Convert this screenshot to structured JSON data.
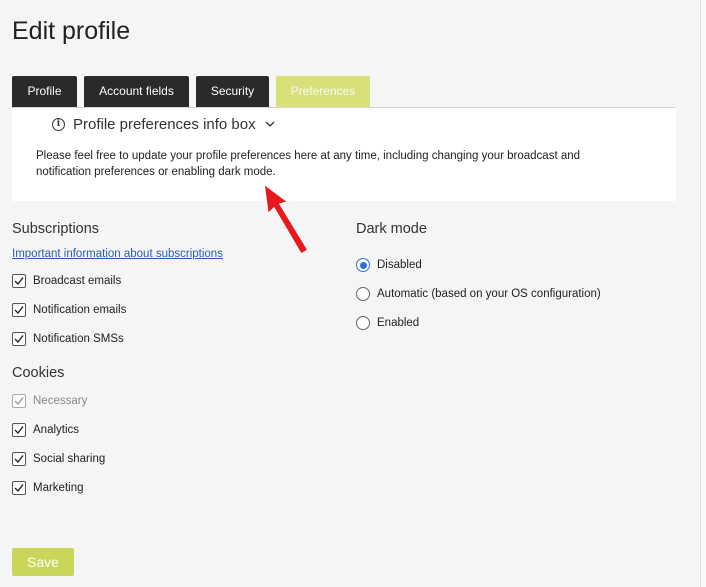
{
  "page_title": "Edit profile",
  "tabs": [
    {
      "label": "Profile",
      "active": false
    },
    {
      "label": "Account fields",
      "active": false
    },
    {
      "label": "Security",
      "active": false
    },
    {
      "label": "Preferences",
      "active": true
    }
  ],
  "info_box": {
    "icon": "info-circle-icon",
    "title": "Profile preferences info box",
    "text_line1": "Please feel free to update your profile preferences here at any time, including changing your broadcast and",
    "text_line2": "notification preferences or enabling dark mode."
  },
  "subscriptions": {
    "heading": "Subscriptions",
    "link": "Important information about subscriptions",
    "items": [
      {
        "label": "Broadcast emails",
        "checked": true
      },
      {
        "label": "Notification emails",
        "checked": true
      },
      {
        "label": "Notification SMSs",
        "checked": true
      }
    ]
  },
  "cookies": {
    "heading": "Cookies",
    "items": [
      {
        "label": "Necessary",
        "checked": true,
        "disabled": true
      },
      {
        "label": "Analytics",
        "checked": true
      },
      {
        "label": "Social sharing",
        "checked": true
      },
      {
        "label": "Marketing",
        "checked": true
      }
    ]
  },
  "dark_mode": {
    "heading": "Dark mode",
    "options": [
      {
        "label": "Disabled",
        "selected": true
      },
      {
        "label": "Automatic (based on your OS configuration)",
        "selected": false
      },
      {
        "label": "Enabled",
        "selected": false
      }
    ]
  },
  "save_label": "Save",
  "colors": {
    "tab_dark": "#2a2a2a",
    "tab_active": "#d8e07a",
    "save_button": "#c9d65a",
    "link": "#2a5db0",
    "radio_selected": "#2d6ce0",
    "annotation_arrow": "#e8191c"
  }
}
